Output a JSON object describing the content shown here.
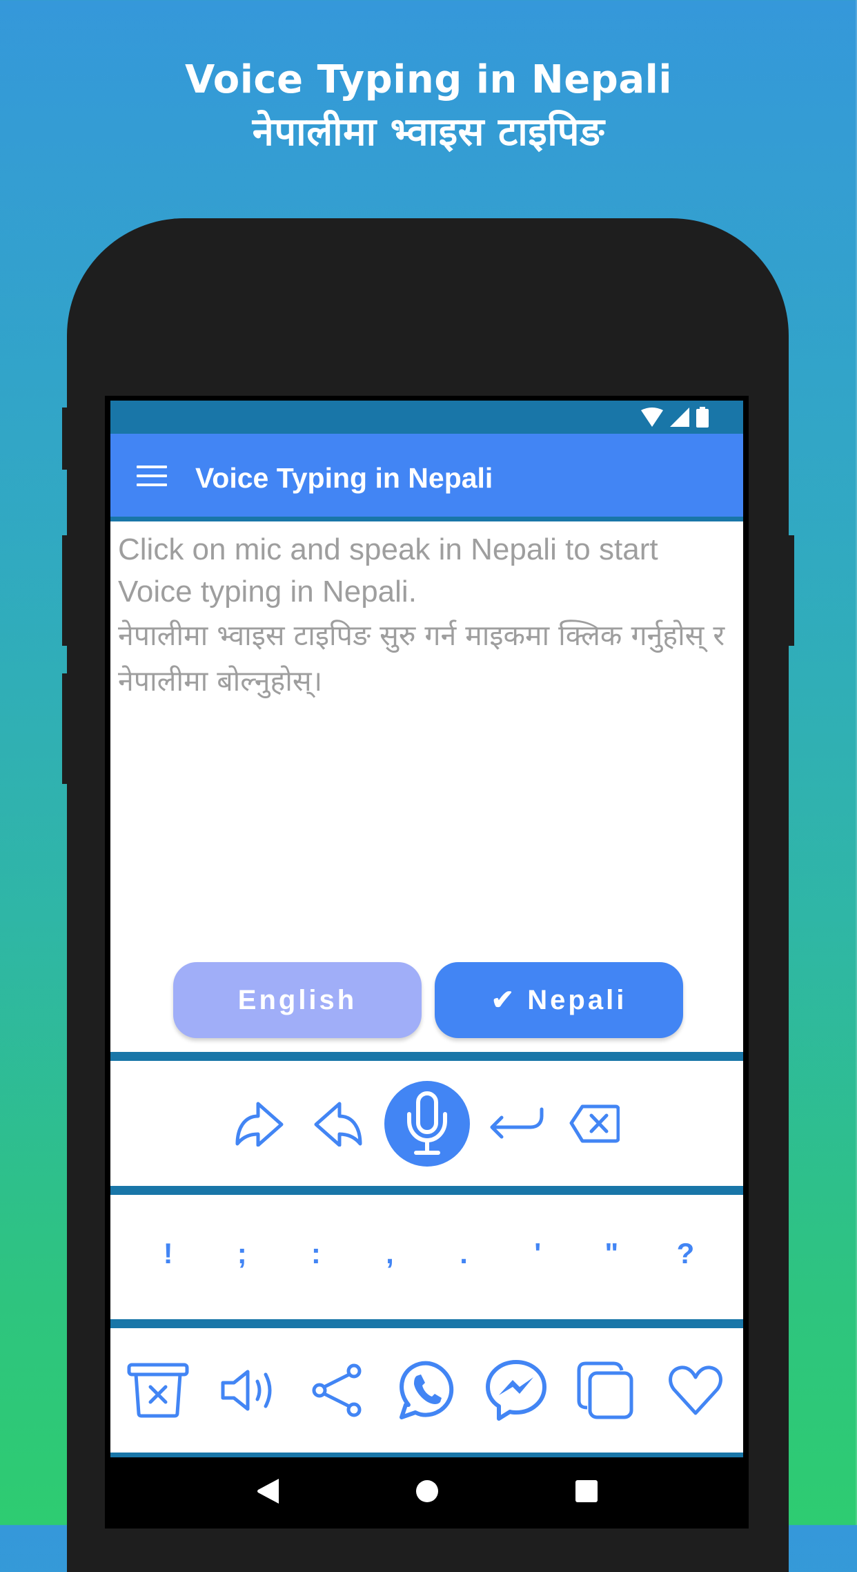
{
  "promo": {
    "title_en": "Voice Typing in Nepali",
    "title_np": "नेपालीमा भ्वाइस टाइपिङ"
  },
  "status_bar": {
    "icons": [
      "wifi-icon",
      "signal-icon",
      "battery-icon"
    ]
  },
  "app_bar": {
    "menu_icon": "hamburger-menu-icon",
    "title": "Voice Typing in Nepali"
  },
  "editor": {
    "placeholder_en": "Click on mic and speak in Nepali to start Voice typing in Nepali.",
    "placeholder_np": "नेपालीमा भ्वाइस टाइपिङ सुरु गर्न माइकमा क्लिक गर्नुहोस् र नेपालीमा बोल्नुहोस्।",
    "value": ""
  },
  "language_toggle": {
    "english_label": "English",
    "nepali_label": "✔ Nepali",
    "selected": "Nepali"
  },
  "actions": [
    {
      "name": "redo",
      "icon": "redo-arrow-icon"
    },
    {
      "name": "undo",
      "icon": "undo-arrow-icon"
    },
    {
      "name": "mic",
      "icon": "microphone-icon"
    },
    {
      "name": "enter",
      "icon": "enter-return-icon"
    },
    {
      "name": "backspace",
      "icon": "backspace-icon"
    }
  ],
  "punctuation": [
    "!",
    ";",
    ":",
    ",",
    ".",
    "'",
    "\"",
    "?"
  ],
  "tools": [
    {
      "name": "clear",
      "icon": "trash-clear-icon"
    },
    {
      "name": "speak",
      "icon": "speaker-icon"
    },
    {
      "name": "share",
      "icon": "share-icon"
    },
    {
      "name": "whatsapp",
      "icon": "whatsapp-icon"
    },
    {
      "name": "messenger",
      "icon": "messenger-icon"
    },
    {
      "name": "copy",
      "icon": "copy-icon"
    },
    {
      "name": "favorite",
      "icon": "heart-icon"
    }
  ],
  "nav_bar": {
    "buttons": [
      "back-icon",
      "home-icon",
      "recents-icon"
    ]
  },
  "colors": {
    "primary": "#4285F4",
    "primary_dark": "#1976A8",
    "english_button": "#A0AEF8",
    "placeholder_text": "#9E9E9E",
    "phone_body": "#1E1E1E",
    "bg_top": "#3598DA",
    "bg_bottom": "#2ECC71"
  }
}
